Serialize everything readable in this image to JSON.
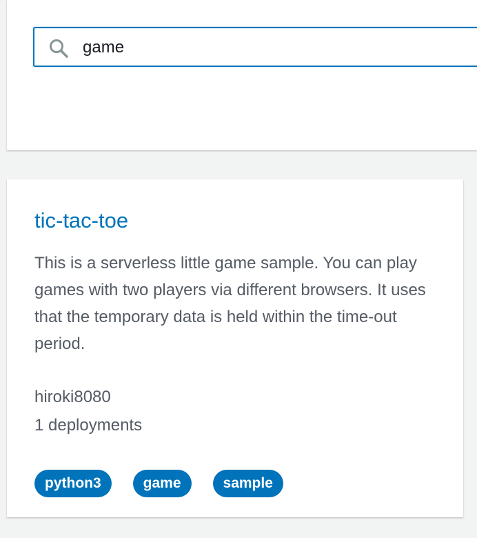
{
  "search": {
    "value": "game",
    "icon": "search-icon"
  },
  "colors": {
    "accent": "#0073bb",
    "background": "#f2f3f3",
    "text": "#545b64"
  },
  "results": [
    {
      "title": "tic-tac-toe",
      "description": "This is a serverless little game sample. You can play games with two players via different browsers. It uses that the temporary data is held within the time-out period.",
      "author": "hiroki8080",
      "deployments": "1 deployments",
      "tags": [
        "python3",
        "game",
        "sample"
      ]
    }
  ]
}
